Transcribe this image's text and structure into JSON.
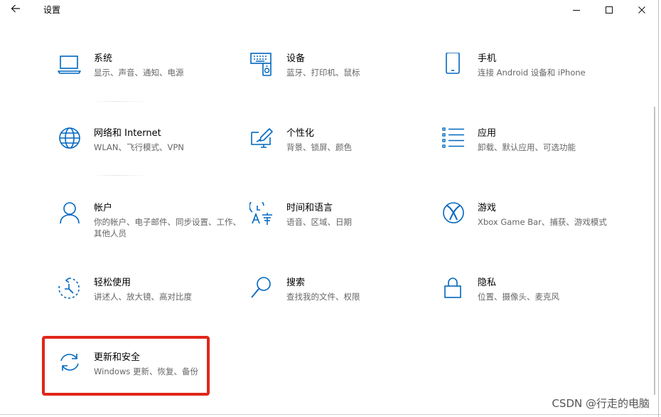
{
  "window": {
    "title": "设置"
  },
  "colors": {
    "accent": "#0067c0",
    "highlight_border": "#e0261b"
  },
  "tiles": [
    {
      "name": "系统",
      "desc": "显示、声音、通知、电源",
      "icon": "laptop-icon"
    },
    {
      "name": "设备",
      "desc": "蓝牙、打印机、鼠标",
      "icon": "devices-icon"
    },
    {
      "name": "手机",
      "desc": "连接 Android 设备和 iPhone",
      "icon": "phone-icon"
    },
    {
      "name": "网络和 Internet",
      "desc": "WLAN、飞行模式、VPN",
      "icon": "globe-icon"
    },
    {
      "name": "个性化",
      "desc": "背景、锁屏、颜色",
      "icon": "personalization-icon"
    },
    {
      "name": "应用",
      "desc": "卸载、默认应用、可选功能",
      "icon": "apps-list-icon"
    },
    {
      "name": "帐户",
      "desc": "你的帐户、电子邮件、同步设置、工作、其他人员",
      "icon": "person-icon"
    },
    {
      "name": "时间和语言",
      "desc": "语音、区域、日期",
      "icon": "time-language-icon"
    },
    {
      "name": "游戏",
      "desc": "Xbox Game Bar、捕获、游戏模式",
      "icon": "xbox-icon"
    },
    {
      "name": "轻松使用",
      "desc": "讲述人、放大镜、高对比度",
      "icon": "ease-of-access-icon"
    },
    {
      "name": "搜索",
      "desc": "查找我的文件、权限",
      "icon": "search-icon"
    },
    {
      "name": "隐私",
      "desc": "位置、摄像头、麦克风",
      "icon": "lock-icon"
    },
    {
      "name": "更新和安全",
      "desc": "Windows 更新、恢复、备份",
      "icon": "sync-icon"
    }
  ],
  "watermark": "CSDN @行走的电脑"
}
